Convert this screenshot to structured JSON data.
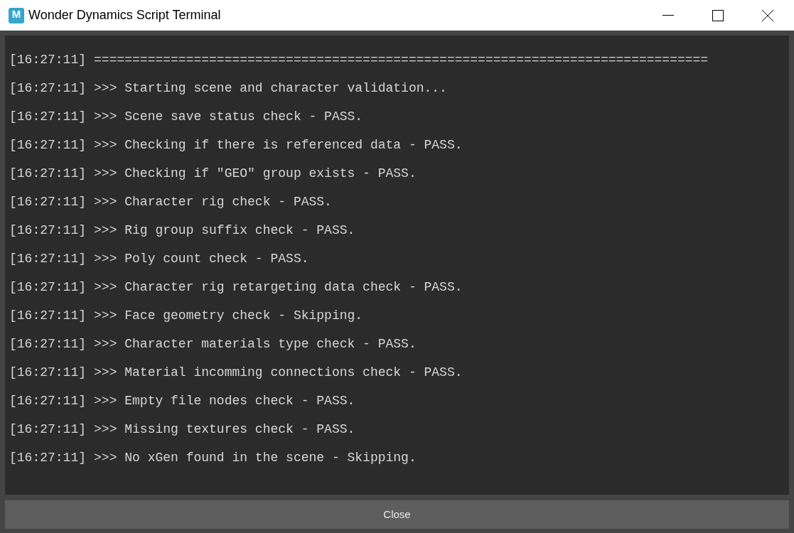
{
  "window": {
    "title": "Wonder Dynamics Script Terminal",
    "app_icon_letter": "M"
  },
  "log": [
    {
      "time": "[16:27:11]",
      "message": "================================================================================"
    },
    {
      "time": "[16:27:11]",
      "message": ">>> Starting scene and character validation..."
    },
    {
      "time": "[16:27:11]",
      "message": ">>> Scene save status check - PASS."
    },
    {
      "time": "[16:27:11]",
      "message": ">>> Checking if there is referenced data - PASS."
    },
    {
      "time": "[16:27:11]",
      "message": ">>> Checking if \"GEO\" group exists - PASS."
    },
    {
      "time": "[16:27:11]",
      "message": ">>> Character rig check - PASS."
    },
    {
      "time": "[16:27:11]",
      "message": ">>> Rig group suffix check - PASS."
    },
    {
      "time": "[16:27:11]",
      "message": ">>> Poly count check - PASS."
    },
    {
      "time": "[16:27:11]",
      "message": ">>> Character rig retargeting data check - PASS."
    },
    {
      "time": "[16:27:11]",
      "message": ">>> Face geometry check - Skipping."
    },
    {
      "time": "[16:27:11]",
      "message": ">>> Character materials type check - PASS."
    },
    {
      "time": "[16:27:11]",
      "message": ">>> Material incomming connections check - PASS."
    },
    {
      "time": "[16:27:11]",
      "message": ">>> Empty file nodes check - PASS."
    },
    {
      "time": "[16:27:11]",
      "message": ">>> Missing textures check - PASS."
    },
    {
      "time": "[16:27:11]",
      "message": ">>> No xGen found in the scene - Skipping."
    }
  ],
  "buttons": [
    "Close"
  ]
}
